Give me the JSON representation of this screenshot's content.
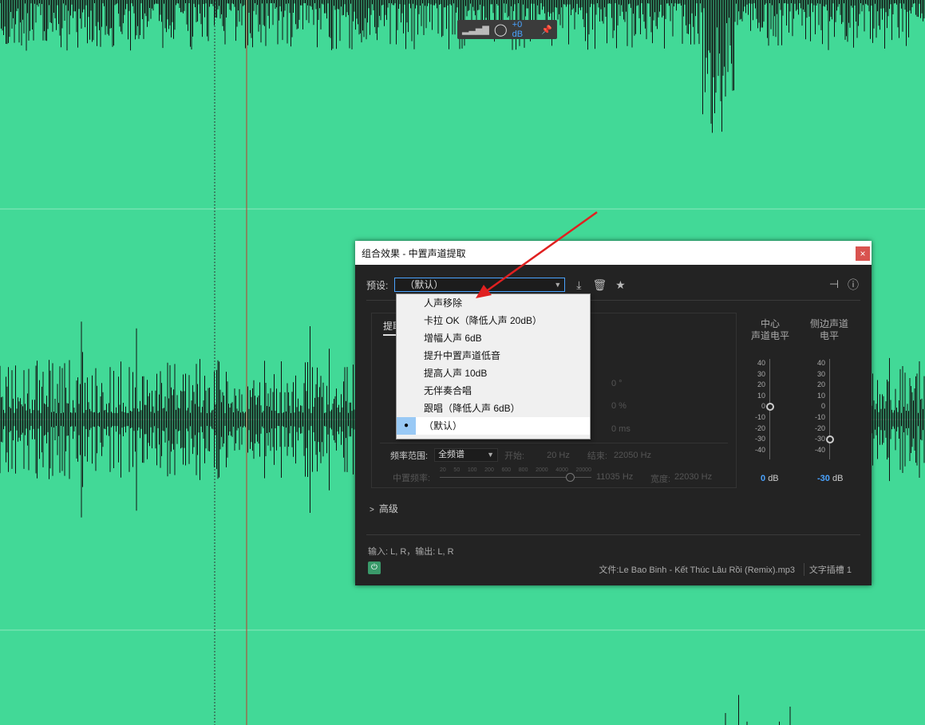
{
  "hud": {
    "level": "+0 dB"
  },
  "dialog": {
    "title": "组合效果 - 中置声道提取",
    "close_glyph": "×",
    "preset_label": "预设:",
    "preset_value": "（默认）",
    "panel_tab": "提取",
    "values": {
      "phase": "0 °",
      "percent": "0 %",
      "ms": "0 ms"
    },
    "meters": [
      {
        "title_line1": "中心",
        "title_line2": "声道电平",
        "value": "0",
        "unit": "dB"
      },
      {
        "title_line1": "侧边声道",
        "title_line2": "电平",
        "value": "-30",
        "unit": "dB"
      }
    ],
    "meter_scale": [
      "40",
      "30",
      "20",
      "10",
      "0",
      "-10",
      "-20",
      "-30",
      "-40"
    ],
    "freq": {
      "label": "频率范围:",
      "select_value": "全频谱",
      "start_label": "开始:",
      "start_value": "20 Hz",
      "end_label": "结束:",
      "end_value": "22050 Hz",
      "center_label": "中置频率:",
      "ruler": [
        "20",
        "50",
        "100",
        "200",
        "600",
        "800",
        "2000",
        "4000",
        "20000"
      ],
      "center_value": "11035 Hz",
      "width_label": "宽度:",
      "width_value": "22030 Hz"
    },
    "advanced_label": "高级",
    "io_text": "输入: L, R，输出: L, R",
    "file_text": "文件:Le Bao Binh - Kết Thúc Lâu Rồi (Remix).mp3",
    "slot_text": "文字插槽 1"
  },
  "dropdown": {
    "items": [
      "人声移除",
      "卡拉 OK（降低人声 20dB）",
      "增幅人声 6dB",
      "提升中置声道低音",
      "提高人声 10dB",
      "无伴奏合唱",
      "跟唱（降低人声 6dB）",
      "（默认）"
    ],
    "selected_index": 7,
    "check_glyph": "●"
  },
  "colors": {
    "waveform_bg": "#42d997",
    "accent": "#4aa3ff",
    "arrow": "#e02020"
  }
}
